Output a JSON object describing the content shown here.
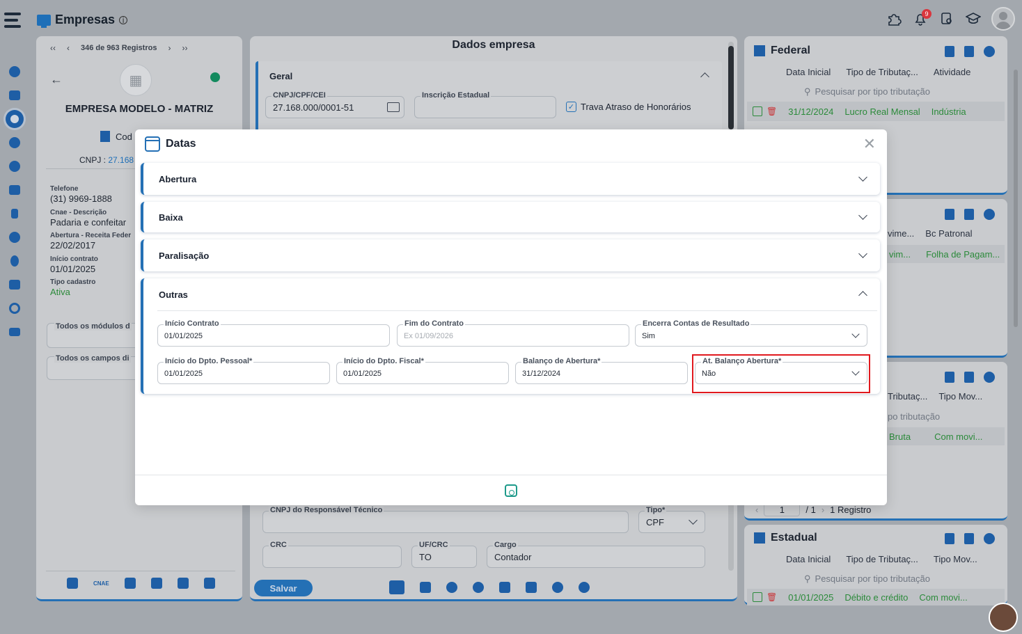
{
  "app": {
    "title": "Empresas"
  },
  "topbar": {
    "notification_count": "9"
  },
  "left": {
    "pager_text": "346 de 963 Registros",
    "company_name": "EMPRESA MODELO - MATRIZ",
    "cod_label": "Cod",
    "cnpj_label": "CNPJ :",
    "cnpj_value": "27.168",
    "fields": [
      {
        "label": "Telefone",
        "value": "(31) 9969-1888"
      },
      {
        "label": "Cnae - Descrição",
        "value": "Padaria e confeitar"
      },
      {
        "label": "Abertura - Receita Feder",
        "value": "22/02/2017"
      },
      {
        "label": "Início contrato",
        "value": "01/01/2025"
      },
      {
        "label": "Tipo cadastro",
        "value": "Ativa"
      }
    ],
    "select_modules": "Todos os módulos d",
    "select_fields": "Todos os campos di",
    "bottom_cnae": "CNAE"
  },
  "middle": {
    "title": "Dados empresa",
    "geral": "Geral",
    "cnpj_label": "CNPJ/CPF/CEI",
    "cnpj_value": "27.168.000/0001-51",
    "ie_label": "Inscrição Estadual",
    "trava_label": "Trava Atraso de Honorários",
    "resp_label": "CNPJ do Responsável Técnico",
    "tipo_label": "Tipo*",
    "tipo_value": "CPF",
    "crc_label": "CRC",
    "ufcrc_label": "UF/CRC",
    "ufcrc_value": "TO",
    "cargo_label": "Cargo",
    "cargo_value": "Contador",
    "salvar": "Salvar"
  },
  "modal": {
    "title": "Datas",
    "sections": [
      "Abertura",
      "Baixa",
      "Paralisação",
      "Outras"
    ],
    "fields": {
      "inicio_contrato": {
        "label": "Início Contrato",
        "value": "01/01/2025"
      },
      "fim_contrato": {
        "label": "Fim do Contrato",
        "placeholder": "Ex 01/09/2026"
      },
      "encerra": {
        "label": "Encerra Contas de Resultado",
        "value": "Sim"
      },
      "inicio_pessoal": {
        "label": "Início do Dpto. Pessoal*",
        "value": "01/01/2025"
      },
      "inicio_fiscal": {
        "label": "Início do Dpto. Fiscal*",
        "value": "01/01/2025"
      },
      "balanco": {
        "label": "Balanço de Abertura*",
        "value": "31/12/2024"
      },
      "at_balanco": {
        "label": "At. Balanço Abertura*",
        "value": "Não"
      }
    }
  },
  "right": {
    "federal": {
      "title": "Federal",
      "cols": [
        "Data Inicial",
        "Tipo de Tributaç...",
        "Atividade"
      ],
      "search": "Pesquisar por tipo tributação",
      "row": [
        "31/12/2024",
        "Lucro Real Mensal",
        "Indústria"
      ]
    },
    "second": {
      "cols": [
        "vime...",
        "Bc Patronal"
      ],
      "row": [
        "vim...",
        "Folha de Pagam..."
      ]
    },
    "third": {
      "cols": [
        "Tributaç...",
        "Tipo Mov..."
      ],
      "search": "po tributação",
      "row": [
        "Bruta",
        "Com movi..."
      ],
      "page": "1",
      "total": "/ 1",
      "registros": "1 Registro"
    },
    "estadual": {
      "title": "Estadual",
      "cols": [
        "Data Inicial",
        "Tipo de Tributaç...",
        "Tipo Mov..."
      ],
      "search": "Pesquisar por tipo tributação",
      "row": [
        "01/01/2025",
        "Débito e crédito",
        "Com movi..."
      ]
    }
  }
}
